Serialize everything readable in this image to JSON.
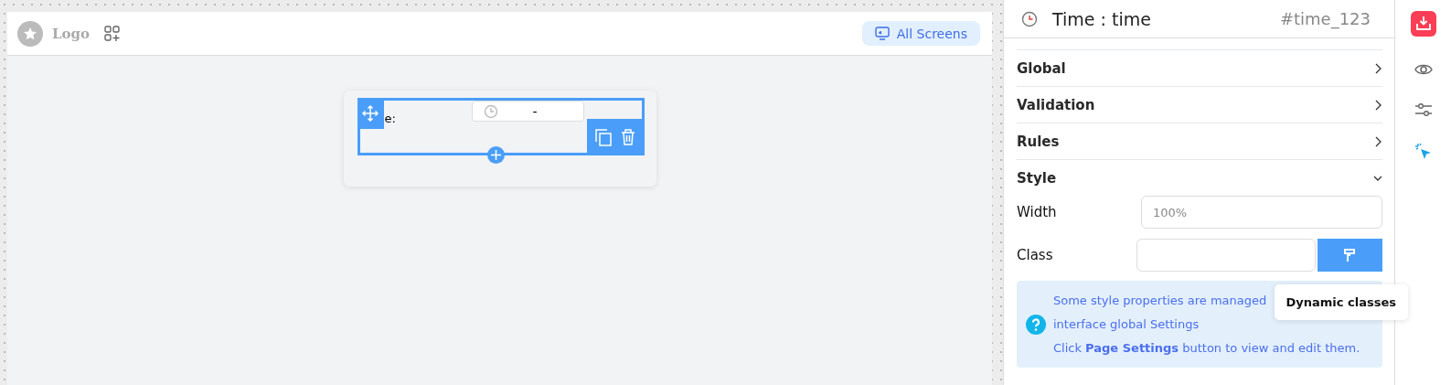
{
  "header": {
    "logo": "Logo",
    "screens_button": "All Screens"
  },
  "widget": {
    "label": "e:",
    "time_value": "-"
  },
  "panel": {
    "title": "Time : time",
    "id": "#time_123",
    "sections": [
      {
        "label": "Global",
        "expanded": false
      },
      {
        "label": "Validation",
        "expanded": false
      },
      {
        "label": "Rules",
        "expanded": false
      },
      {
        "label": "Style",
        "expanded": true
      }
    ],
    "width": {
      "label": "Width",
      "placeholder": "100%"
    },
    "class": {
      "label": "Class"
    },
    "tooltip": "Dynamic classes",
    "info_lines": [
      "Some style properties are managed",
      "interface global Settings",
      "Click **Page Settings** button to view and edit them."
    ]
  }
}
